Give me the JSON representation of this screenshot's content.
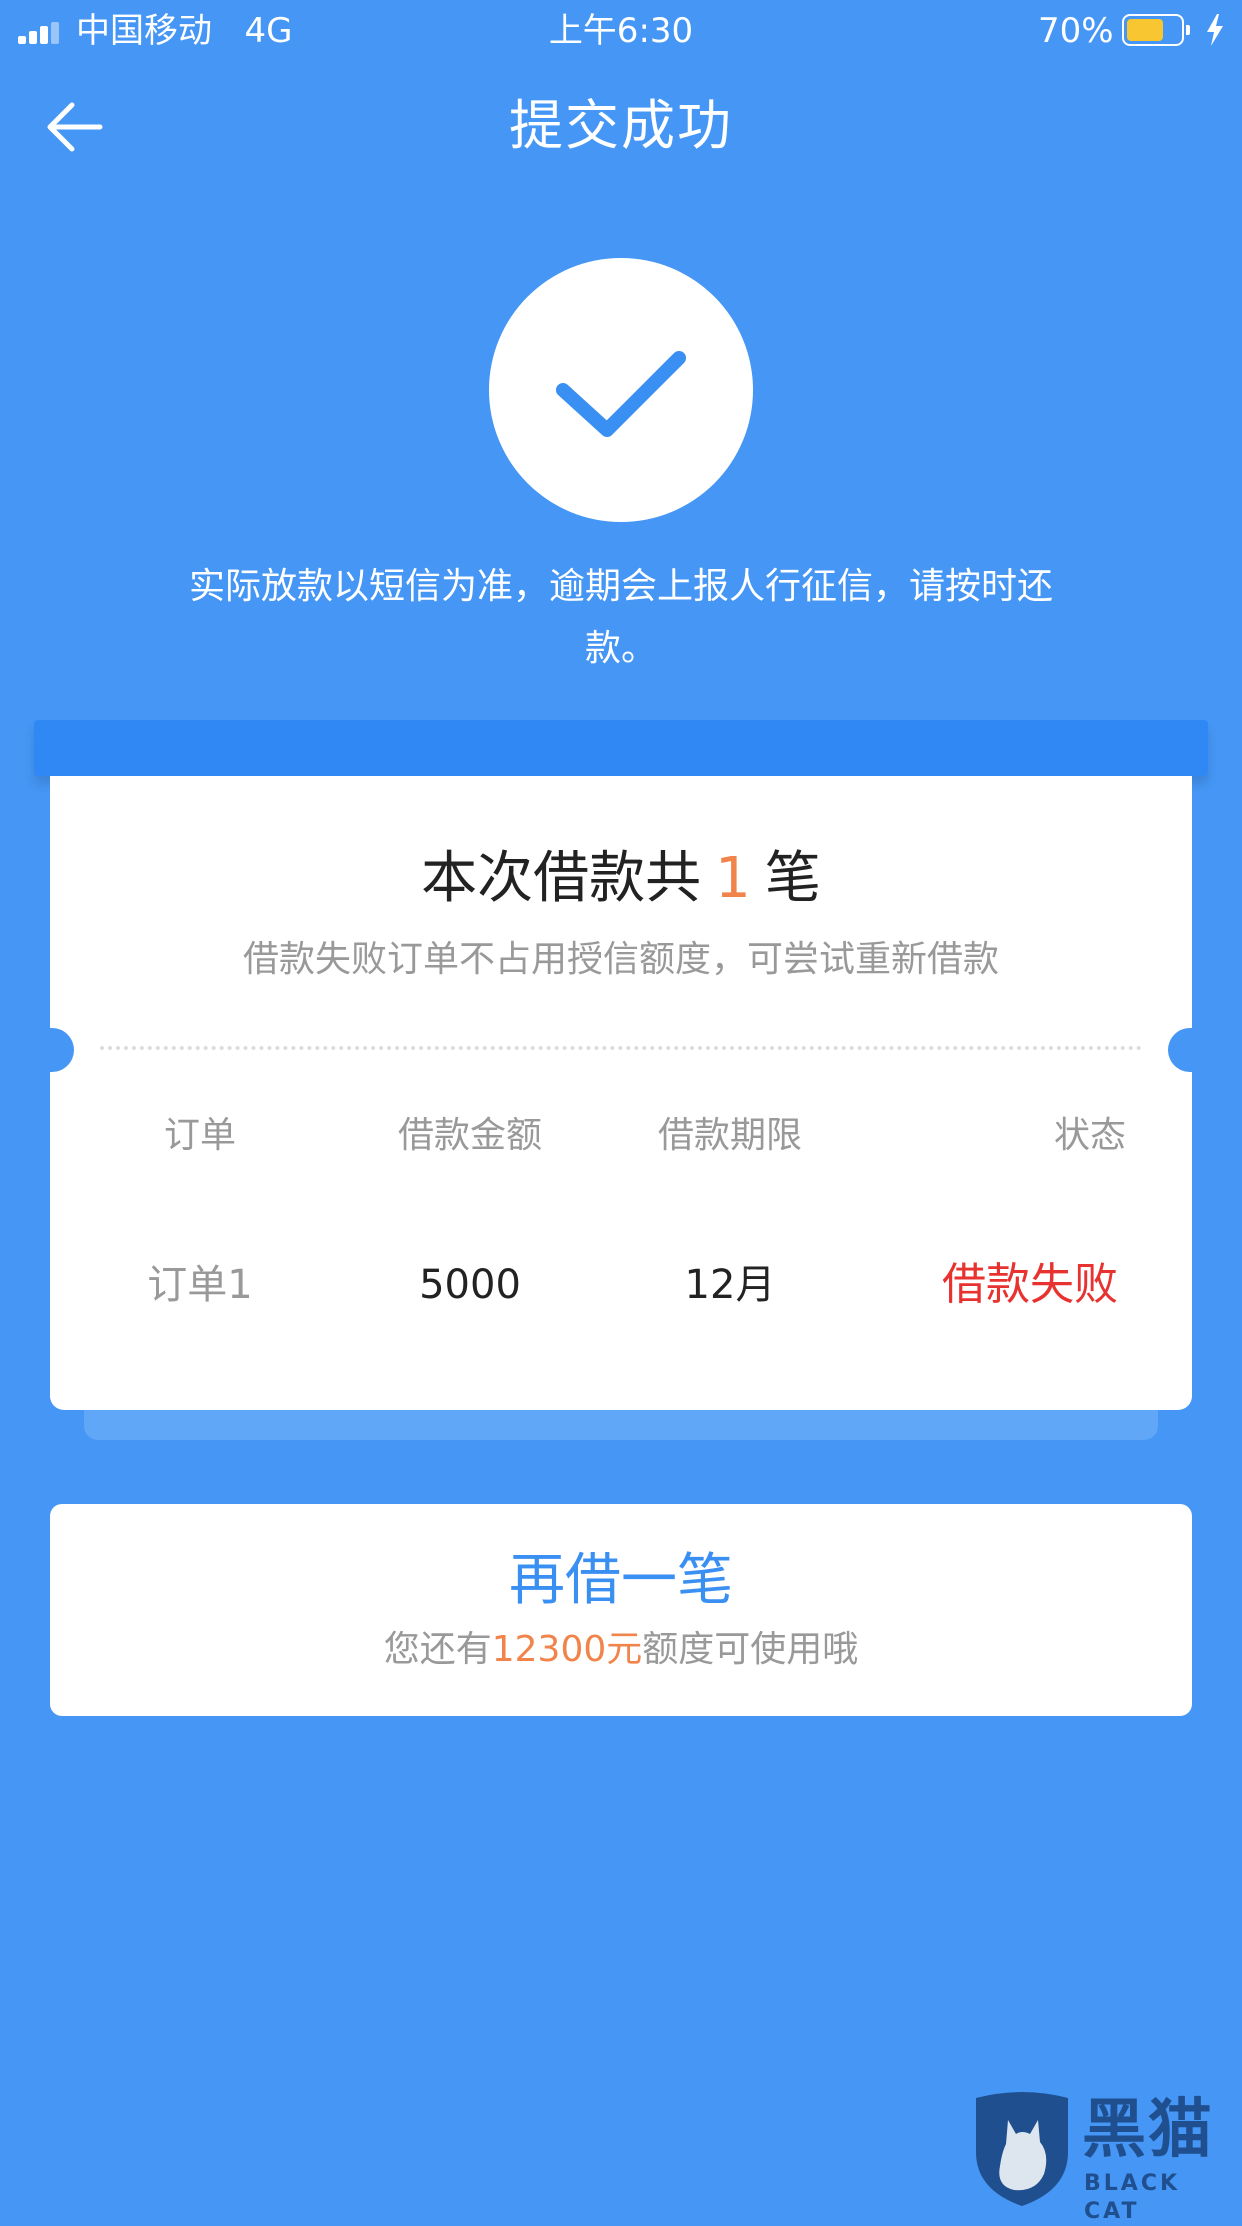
{
  "status_bar": {
    "carrier": "中国移动",
    "network": "4G",
    "time": "上午6:30",
    "battery_pct": "70%",
    "battery_level": 0.7,
    "battery_color": "#f7c631"
  },
  "nav": {
    "back_icon": "arrow-left-icon",
    "title": "提交成功"
  },
  "result": {
    "icon": "checkmark-icon",
    "notice": "实际放款以短信为准，逾期会上报人行征信，请按时还款。"
  },
  "card": {
    "title_prefix": "本次借款共",
    "count": "1",
    "title_suffix": "笔",
    "subtitle": "借款失败订单不占用授信额度，可尝试重新借款",
    "columns": [
      "订单",
      "借款金额",
      "借款期限",
      "状态"
    ],
    "rows": [
      {
        "order": "订单1",
        "amount": "5000",
        "term": "12月",
        "status": "借款失败"
      }
    ]
  },
  "again": {
    "title": "再借一笔",
    "sub_prefix": "您还有",
    "amount": "12300元",
    "sub_suffix": "额度可使用哦"
  },
  "watermark": {
    "cn": "黑猫",
    "en": "BLACK CAT"
  },
  "colors": {
    "background": "#4596f5",
    "accent_orange": "#f0844a",
    "fail_red": "#e8322f",
    "button_blue": "#3a8ff3"
  }
}
